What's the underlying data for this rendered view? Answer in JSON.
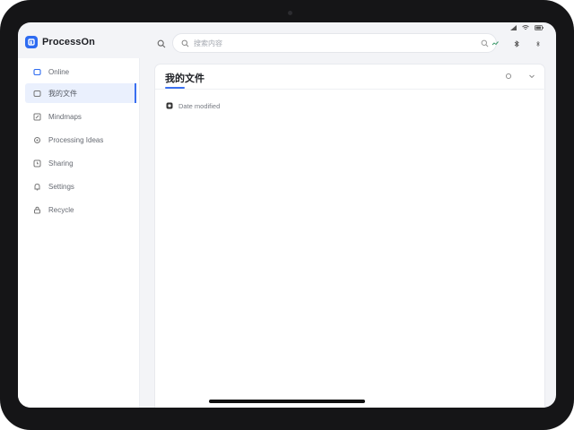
{
  "app": {
    "name": "ProcessOn",
    "brand_color": "#2d6bf1",
    "accent_color": "#3a6ff0"
  },
  "search": {
    "value": "",
    "placeholder": "搜索内容",
    "icon": "search-icon"
  },
  "top_actions": [
    "share-icon",
    "bluetooth-icon",
    "more-icon"
  ],
  "sidebar": {
    "items": [
      {
        "label": "Online",
        "icon": "folder-icon",
        "active": false
      },
      {
        "label": "我的文件",
        "icon": "file-icon",
        "active": true
      },
      {
        "label": "Mindmaps",
        "icon": "edit-icon",
        "active": false
      },
      {
        "label": "Processing Ideas",
        "icon": "gear-icon",
        "active": false
      },
      {
        "label": "Sharing",
        "icon": "clock-icon",
        "active": false
      },
      {
        "label": "Settings",
        "icon": "bell-icon",
        "active": false
      },
      {
        "label": "Recycle",
        "icon": "lock-icon",
        "active": false
      }
    ]
  },
  "main": {
    "title": "我的文件",
    "row_label": "Date modified",
    "actions": [
      "settings-icon",
      "chevron-down-icon"
    ]
  }
}
